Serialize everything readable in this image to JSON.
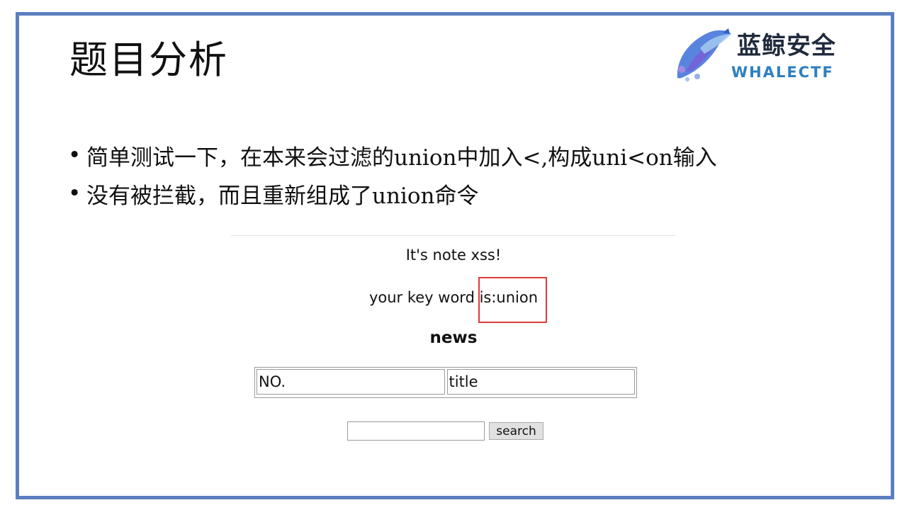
{
  "slide": {
    "title": "题目分析",
    "logo": {
      "name_cn": "蓝鲸安全",
      "name_en": "WHALECTF"
    },
    "bullets": [
      "简单测试一下，在本来会过滤的union中加入<,构成uni<on输入",
      "没有被拦截，而且重新组成了union命令"
    ]
  },
  "webpage": {
    "heading": "It's note xss!",
    "keyword_line": "your key word is:union",
    "news_heading": "news",
    "table_headers": [
      "NO.",
      "title"
    ],
    "search_input_value": "",
    "search_button_label": "search"
  },
  "colors": {
    "frame_border": "#5b7fbf",
    "highlight_box": "#e23a3a",
    "logo_en": "#2e7fc0"
  }
}
